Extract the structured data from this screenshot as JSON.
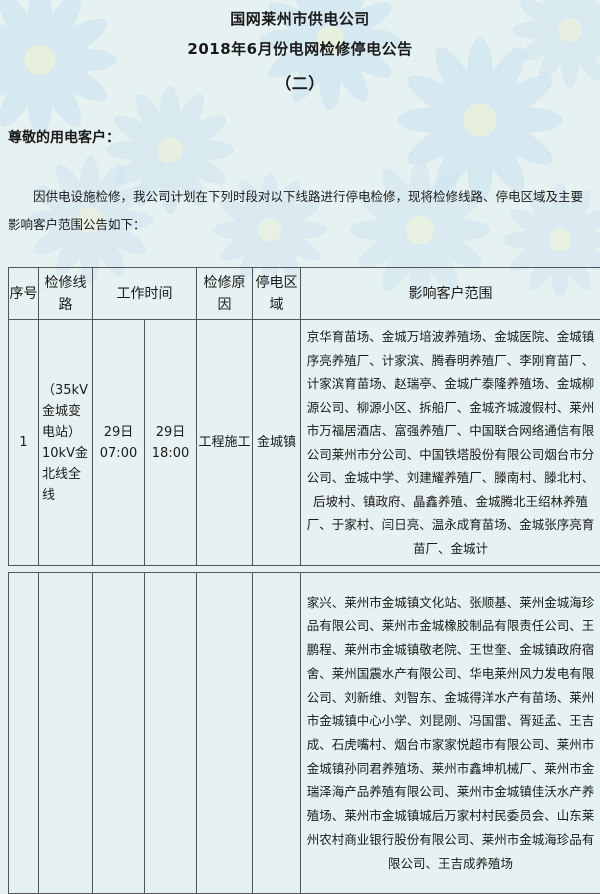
{
  "header": {
    "line1": "国网莱州市供电公司",
    "line2": "2018年6月份电网检修停电公告",
    "line3": "（二）"
  },
  "greeting": "尊敬的用电客户：",
  "intro": "因供电设施检修，我公司计划在下列时段对以下线路进行停电检修，现将检修线路、停电区域及主要影响客户范围公告如下：",
  "table": {
    "headers": {
      "no": "序号",
      "line": "检修线路",
      "time": "工作时间",
      "reason": "检修原因",
      "area": "停电区域",
      "scope": "影响客户范围"
    },
    "row": {
      "no": "1",
      "line": "（35kV金城变电站）10kV金北线全线",
      "start": "29日07:00",
      "end": "29日18:00",
      "reason": "工程施工",
      "area": "金城镇",
      "scope_part1": "京华育苗场、金城万培波养殖场、金城医院、金城镇序亮养殖厂、计家滨、腾春明养殖厂、李刚育苗厂、计家滨育苗场、赵瑞亭、金城广泰隆养殖场、金城柳源公司、柳源小区、拆船厂、金城齐城渡假村、莱州市万福居酒店、富强养殖厂、中国联合网络通信有限公司莱州市分公司、中国铁塔股份有限公司烟台市分公司、金城中学、刘建耀养殖厂、滕南村、滕北村、后坡村、镇政府、晶鑫养殖、金城腾北王绍林养殖厂、于家村、闫日亮、温永成育苗场、金城张序亮育苗厂、金城计",
      "scope_part2": "家兴、莱州市金城镇文化站、张顺基、莱州金城海珍品有限公司、莱州市金城橡胶制品有限责任公司、王鹏程、莱州市金城镇敬老院、王世奎、金城镇政府宿舍、莱州国震水产有限公司、华电莱州风力发电有限公司、刘新维、刘智东、金城得洋水产有苗场、莱州市金城镇中心小学、刘昆刚、冯国雷、胥延孟、王吉成、石虎嘴村、烟台市家家悦超市有限公司、莱州市金城镇孙同君养殖场、莱州市鑫坤机械厂、莱州市金瑞泽海产品养殖有限公司、莱州市金城镇佳沃水产养殖场、莱州市金城镇城后万家村村民委员会、山东莱州农村商业银行股份有限公司、莱州市金城海珍品有限公司、王吉成养殖场"
    }
  },
  "colors": {
    "background": "#e6f2f1",
    "flower_petal": "#cfe3ef",
    "table_border": "#555555"
  }
}
